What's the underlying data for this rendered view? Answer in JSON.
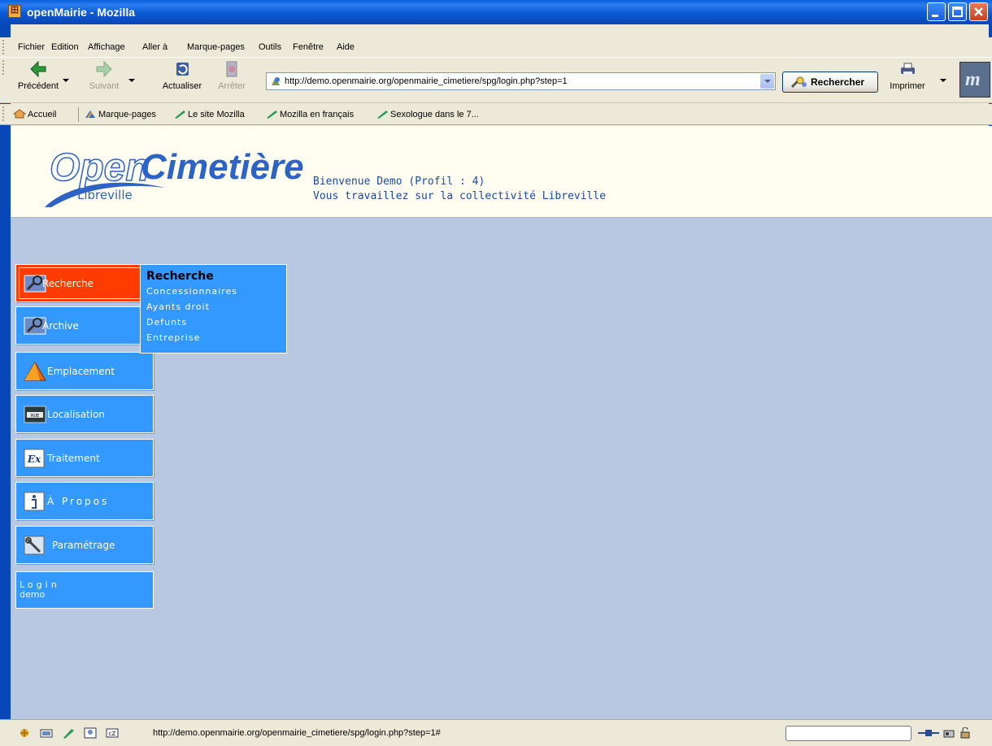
{
  "window": {
    "title": "openMairie - Mozilla",
    "app_icon_glyph": "田"
  },
  "menubar": {
    "items": [
      "Fichier",
      "Edition",
      "Affichage",
      "Aller à",
      "Marque-pages",
      "Outils",
      "Fenêtre",
      "Aide"
    ]
  },
  "toolbar": {
    "back_label": "Précédent",
    "forward_label": "Suivant",
    "reload_label": "Actualiser",
    "stop_label": "Arrêter",
    "url": "http://demo.openmairie.org/openmairie_cimetiere/spg/login.php?step=1",
    "search_label": "Rechercher",
    "print_label": "Imprimer",
    "throbber_glyph": "m"
  },
  "bookmarks": {
    "items": [
      "Accueil",
      "Marque-pages",
      "Le site Mozilla",
      "Mozilla en français",
      "Sexologue dans le 7..."
    ]
  },
  "page": {
    "logo_open": "Open",
    "logo_cimetiere": "Cimetière",
    "logo_city": "Libreville",
    "welcome_line1": "Bienvenue Demo (Profil : 4)",
    "welcome_line2": "Vous travaillez sur la collectivité Libreville",
    "menu": {
      "recherche": "Recherche",
      "archive": "Archive",
      "emplacement": "Emplacement",
      "localisation": "Localisation",
      "traitement": "Traitement",
      "apropos": "À Propos",
      "parametrage": "Paramétrage",
      "login_label": "Login",
      "login_user": "demo"
    },
    "submenu": {
      "title": "Recherche",
      "items": [
        "Concessionnaires",
        "Ayants droit",
        "Defunts",
        "Entreprise"
      ]
    }
  },
  "statusbar": {
    "text": "http://demo.openmairie.org/openmairie_cimetiere/spg/login.php?step=1#"
  },
  "colors": {
    "menu_blue": "#3399ff",
    "menu_active": "#ff3c00",
    "content_bg": "#b8c8e0",
    "header_bg": "#fffef0",
    "logo_blue": "#2d63c6"
  }
}
